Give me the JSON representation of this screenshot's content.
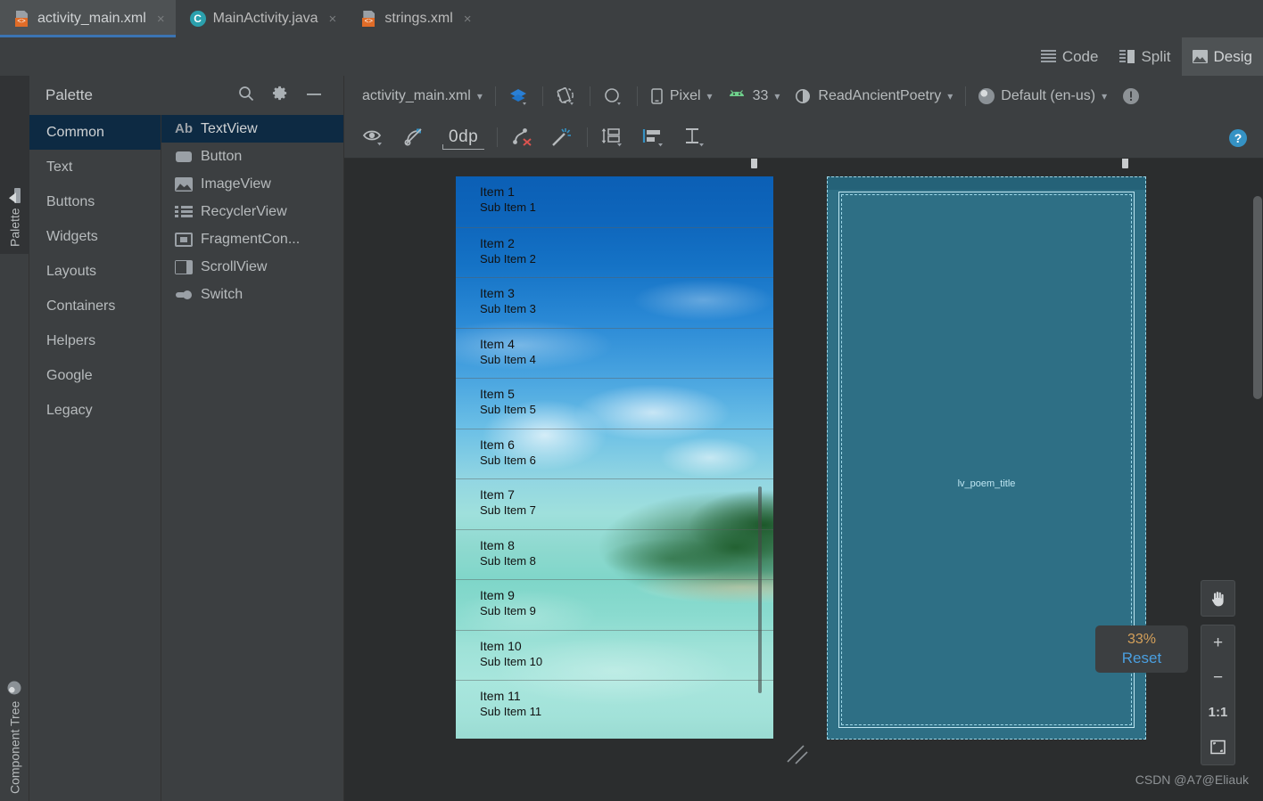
{
  "tabs": [
    {
      "label": "activity_main.xml",
      "icon": "xml-file-icon",
      "active": true,
      "close": "×"
    },
    {
      "label": "MainActivity.java",
      "icon": "java-class-icon",
      "active": false,
      "close": "×"
    },
    {
      "label": "strings.xml",
      "icon": "xml-file-icon",
      "active": false,
      "close": "×"
    }
  ],
  "mode_selector": {
    "code_label": "Code",
    "split_label": "Split",
    "design_label": "Desig",
    "selected": "Design"
  },
  "left_strip": {
    "palette_tab": "Palette",
    "component_tree_tab": "Component Tree"
  },
  "palette": {
    "title": "Palette",
    "search_icon": "search-icon",
    "settings_icon": "gear-icon",
    "minimize_icon": "minimize-icon",
    "categories": [
      {
        "label": "Common",
        "selected": true
      },
      {
        "label": "Text",
        "selected": false
      },
      {
        "label": "Buttons",
        "selected": false
      },
      {
        "label": "Widgets",
        "selected": false
      },
      {
        "label": "Layouts",
        "selected": false
      },
      {
        "label": "Containers",
        "selected": false
      },
      {
        "label": "Helpers",
        "selected": false
      },
      {
        "label": "Google",
        "selected": false
      },
      {
        "label": "Legacy",
        "selected": false
      }
    ],
    "widgets": [
      {
        "label": "TextView",
        "icon": "textview-icon",
        "selected": true
      },
      {
        "label": "Button",
        "icon": "button-icon",
        "selected": false
      },
      {
        "label": "ImageView",
        "icon": "imageview-icon",
        "selected": false
      },
      {
        "label": "RecyclerView",
        "icon": "recyclerview-icon",
        "selected": false
      },
      {
        "label": "FragmentCon...",
        "icon": "fragmentcontainer-icon",
        "selected": false
      },
      {
        "label": "ScrollView",
        "icon": "scrollview-icon",
        "selected": false
      },
      {
        "label": "Switch",
        "icon": "switch-icon",
        "selected": false
      }
    ]
  },
  "design_toolbar": {
    "file_variant": "activity_main.xml",
    "view_options_icon": "layers-icon",
    "orientation_icon": "rotate-device-icon",
    "theme_mode_icon": "night-mode-icon",
    "device": "Pixel",
    "device_icon": "phone-icon",
    "api_level": "33",
    "api_icon": "android-robot-icon",
    "theme": "ReadAncientPoetry",
    "theme_icon": "theme-icon",
    "locale": "Default (en-us)",
    "locale_icon": "globe-icon",
    "issues_icon": "warning-icon"
  },
  "constraint_toolbar": {
    "visibility_icon": "eye-icon",
    "autoconnect_icon": "autoconnect-off-icon",
    "margin_value": "0dp",
    "clear_constraints_icon": "clear-constraints-icon",
    "infer_constraints_icon": "magic-wand-icon",
    "pack_icon": "pack-icon",
    "align_icon": "align-icon",
    "guidelines_icon": "guidelines-icon",
    "help_icon": "help-icon",
    "help_glyph": "?"
  },
  "preview": {
    "list_items": [
      {
        "title": "Item 1",
        "subtitle": "Sub Item 1"
      },
      {
        "title": "Item 2",
        "subtitle": "Sub Item 2"
      },
      {
        "title": "Item 3",
        "subtitle": "Sub Item 3"
      },
      {
        "title": "Item 4",
        "subtitle": "Sub Item 4"
      },
      {
        "title": "Item 5",
        "subtitle": "Sub Item 5"
      },
      {
        "title": "Item 6",
        "subtitle": "Sub Item 6"
      },
      {
        "title": "Item 7",
        "subtitle": "Sub Item 7"
      },
      {
        "title": "Item 8",
        "subtitle": "Sub Item 8"
      },
      {
        "title": "Item 9",
        "subtitle": "Sub Item 9"
      },
      {
        "title": "Item 10",
        "subtitle": "Sub Item 10"
      },
      {
        "title": "Item 11",
        "subtitle": "Sub Item 11"
      }
    ],
    "blueprint_component_label": "lv_poem_title",
    "blueprint_color": "#2e6f85",
    "blueprint_stroke": "#bfe6f2"
  },
  "zoom_controls": {
    "percent": "33%",
    "reset_label": "Reset",
    "pan_icon": "hand-pan-icon",
    "zoom_in": "+",
    "zoom_out": "−",
    "actual_size": "1:1",
    "zoom_to_fit_icon": "zoom-to-fit-icon"
  },
  "watermark": "CSDN @A7@Eliauk",
  "colors": {
    "accent_blue": "#3b74b3",
    "selection_navy": "#0d2a43",
    "panel_bg": "#3c3f41",
    "canvas_bg": "#2b2d2e",
    "orange_badge": "#e06c28",
    "zoom_percent": "#d4a05a",
    "link_blue": "#4a9fe0"
  }
}
